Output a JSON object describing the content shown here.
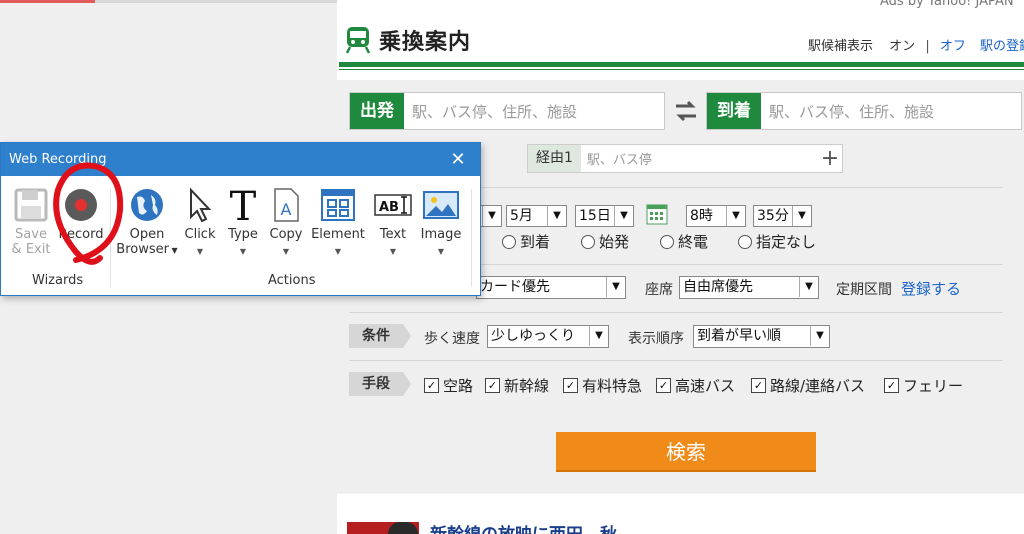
{
  "ads_text": "Ads by Yahoo! JAPAN",
  "title": "乗換案内",
  "station_hint": {
    "label": "駅候補表示",
    "on": "オン",
    "sep": "|",
    "off": "オフ",
    "more": "駅の登録"
  },
  "from": {
    "label": "出発",
    "placeholder": "駅、バス停、住所、施設"
  },
  "to": {
    "label": "到着",
    "placeholder": "駅、バス停、住所、施設"
  },
  "via": {
    "label": "経由1",
    "placeholder": "駅、バス停",
    "add": "+"
  },
  "date": {
    "month": "5月",
    "day": "15日",
    "hour": "8時",
    "minute": "35分"
  },
  "time_type": [
    "到着",
    "始発",
    "終電",
    "指定なし"
  ],
  "fare": {
    "card": "カード優先",
    "seat_label": "座席",
    "seat": "自由席優先",
    "pass_label": "定期区間",
    "pass_link": "登録する"
  },
  "conditions": {
    "tag": "条件",
    "walk_label": "歩く速度",
    "walk": "少しゆっくり",
    "order_label": "表示順序",
    "order": "到着が早い順"
  },
  "means": {
    "tag": "手段",
    "items": [
      "空路",
      "新幹線",
      "有料特急",
      "高速バス",
      "路線/連絡バス",
      "フェリー"
    ]
  },
  "search_button": "検索",
  "news_headline": "新幹線の放映に西田…秋",
  "dialog": {
    "title": "Web Recording",
    "close": "✕",
    "buttons": {
      "save": [
        "Save",
        "& Exit"
      ],
      "record": "Record",
      "open_browser": [
        "Open",
        "Browser"
      ],
      "click": "Click",
      "type": "Type",
      "copy": "Copy",
      "element": "Element",
      "text": "Text",
      "image": "Image"
    },
    "groups": {
      "wizards": "Wizards",
      "actions": "Actions"
    }
  },
  "colors": {
    "brand_green": "#1f8a3d",
    "search_orange": "#f08a19",
    "dialog_blue": "#2f80cc",
    "annotation_red": "#e0101a",
    "link_blue": "#1a63c7"
  }
}
